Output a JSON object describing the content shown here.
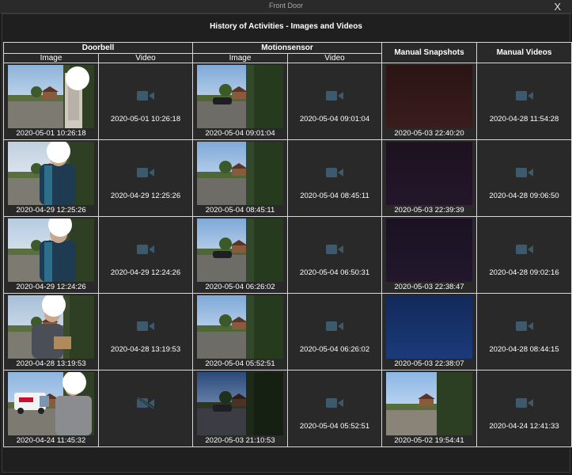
{
  "window": {
    "title": "Front Door",
    "close_label": "X"
  },
  "heading": "History of Activities - Images and Videos",
  "columns": {
    "doorbell": "Doorbell",
    "motionsensor": "Motionsensor",
    "image": "Image",
    "video": "Video",
    "manual_snapshots": "Manual Snapshots",
    "manual_videos": "Manual Videos"
  },
  "rows": [
    {
      "doorbell_image": "2020-05-01 10:26:18",
      "doorbell_video": "2020-05-01 10:26:18",
      "motion_image": "2020-05-04 09:01:04",
      "motion_video": "2020-05-04 09:01:04",
      "snapshot": "2020-05-03 22:40:20",
      "manual_video": "2020-04-28 11:54:28"
    },
    {
      "doorbell_image": "2020-04-29 12:25:26",
      "doorbell_video": "2020-04-29 12:25:26",
      "motion_image": "2020-05-04 08:45:11",
      "motion_video": "2020-05-04 08:45:11",
      "snapshot": "2020-05-03 22:39:39",
      "manual_video": "2020-04-28 09:06:50"
    },
    {
      "doorbell_image": "2020-04-29 12:24:26",
      "doorbell_video": "2020-04-29 12:24:26",
      "motion_image": "2020-05-04 06:26:02",
      "motion_video": "2020-05-04 06:50:31",
      "snapshot": "2020-05-03 22:38:47",
      "manual_video": "2020-04-28 09:02:16"
    },
    {
      "doorbell_image": "2020-04-28 13:19:53",
      "doorbell_video": "2020-04-28 13:19:53",
      "motion_image": "2020-05-04 05:52:51",
      "motion_video": "2020-05-04 06:26:02",
      "snapshot": "2020-05-03 22:38:07",
      "manual_video": "2020-04-28 08:44:15"
    },
    {
      "doorbell_image": "2020-04-24 11:45:32",
      "doorbell_video": "",
      "motion_image": "2020-05-03 21:10:53",
      "motion_video": "2020-05-04 05:52:51",
      "snapshot": "2020-05-02 19:54:41",
      "manual_video": "2020-04-24 12:41:33"
    }
  ],
  "icons": {
    "video": "video-camera-icon",
    "video_missing": "video-camera-off-icon"
  },
  "colors": {
    "background": "#1f1f1f",
    "cell": "#292929",
    "grid_line": "#d8d8d8",
    "video_icon": "#3c5a6b"
  }
}
